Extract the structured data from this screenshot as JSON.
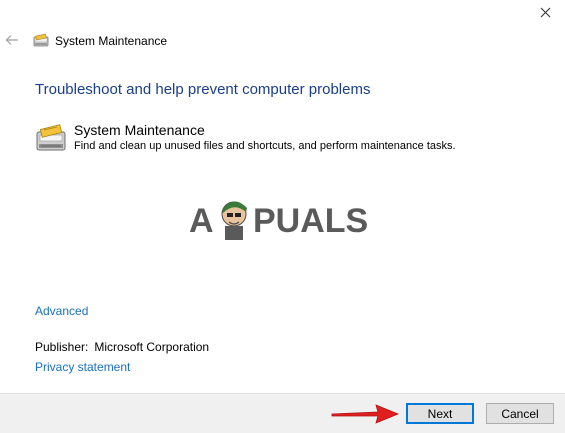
{
  "window": {
    "title": "System Maintenance"
  },
  "heading": "Troubleshoot and help prevent computer problems",
  "task": {
    "name": "System Maintenance",
    "description": "Find and clean up unused files and shortcuts, and perform maintenance tasks."
  },
  "watermark": {
    "left": "A",
    "right": "PUALS"
  },
  "links": {
    "advanced": "Advanced",
    "privacy": "Privacy statement"
  },
  "publisher": {
    "label": "Publisher:",
    "value": "Microsoft Corporation"
  },
  "buttons": {
    "next": "Next",
    "cancel": "Cancel"
  },
  "colors": {
    "heading": "#1a3e8c",
    "link": "#1a6fc4",
    "focus": "#0078d7",
    "arrow": "#e02020"
  }
}
